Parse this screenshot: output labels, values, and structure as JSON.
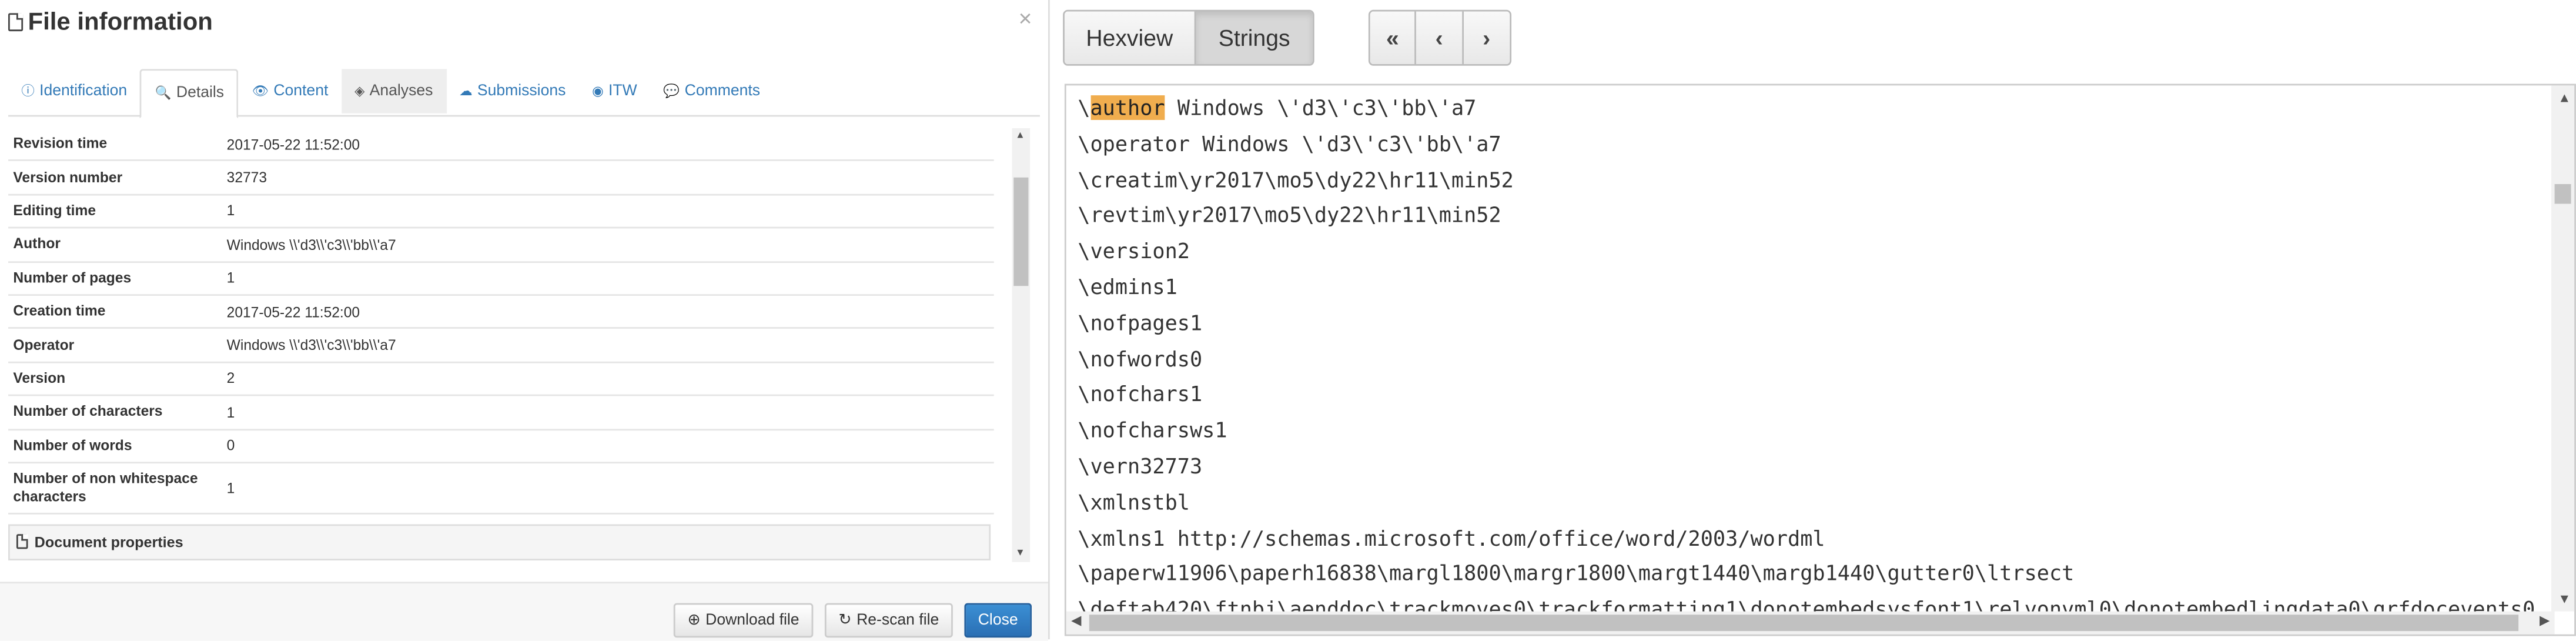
{
  "modal": {
    "title": "File information",
    "close_glyph": "×",
    "tabs": [
      {
        "label": "Identification",
        "icon": "ⓘ"
      },
      {
        "label": "Details",
        "icon": "🔍"
      },
      {
        "label": "Content",
        "icon": "👁"
      },
      {
        "label": "Analyses",
        "icon": "◈"
      },
      {
        "label": "Submissions",
        "icon": "☁"
      },
      {
        "label": "ITW",
        "icon": "◉"
      },
      {
        "label": "Comments",
        "icon": "💬"
      }
    ],
    "details": [
      {
        "key": "Revision time",
        "value": "2017-05-22 11:52:00"
      },
      {
        "key": "Version number",
        "value": "32773"
      },
      {
        "key": "Editing time",
        "value": "1"
      },
      {
        "key": "Author",
        "value": "Windows \\\\'d3\\\\'c3\\\\'bb\\\\'a7"
      },
      {
        "key": "Number of pages",
        "value": "1"
      },
      {
        "key": "Creation time",
        "value": "2017-05-22 11:52:00"
      },
      {
        "key": "Operator",
        "value": "Windows \\\\'d3\\\\'c3\\\\'bb\\\\'a7"
      },
      {
        "key": "Version",
        "value": "2"
      },
      {
        "key": "Number of characters",
        "value": "1"
      },
      {
        "key": "Number of words",
        "value": "0"
      },
      {
        "key": "Number of non whitespace characters",
        "value": "1"
      }
    ],
    "document_properties": "Document properties",
    "buttons": {
      "download": "Download file",
      "rescan": "Re-scan file",
      "close": "Close"
    }
  },
  "viewer": {
    "modes": {
      "hexview": "Hexview",
      "strings": "Strings"
    },
    "nav": {
      "first": "«",
      "prev": "‹",
      "next": "›"
    },
    "highlight": "author",
    "lines": [
      "\\author Windows \\'d3\\'c3\\'bb\\'a7",
      "\\operator Windows \\'d3\\'c3\\'bb\\'a7",
      "\\creatim\\yr2017\\mo5\\dy22\\hr11\\min52",
      "\\revtim\\yr2017\\mo5\\dy22\\hr11\\min52",
      "\\version2",
      "\\edmins1",
      "\\nofpages1",
      "\\nofwords0",
      "\\nofchars1",
      "\\nofcharsws1",
      "\\vern32773",
      "\\xmlnstbl",
      "\\xmlns1 http://schemas.microsoft.com/office/word/2003/wordml",
      "\\paperw11906\\paperh16838\\margl1800\\margr1800\\margt1440\\margb1440\\gutter0\\ltrsect",
      "\\deftab420\\ftnbj\\aenddoc\\trackmoves0\\trackformatting1\\donotembedsysfont1\\relyonvml0\\donotembedlingdata0\\grfdocevents0"
    ]
  }
}
